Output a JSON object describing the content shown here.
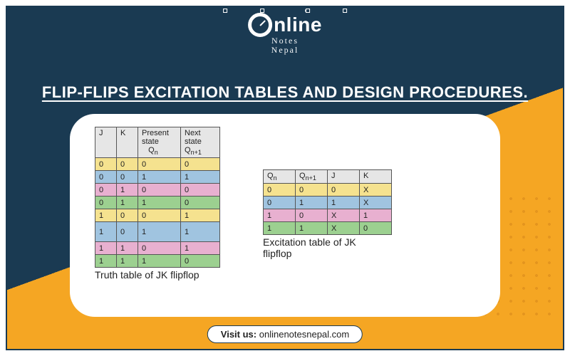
{
  "brand": {
    "main_text": "nline",
    "sub1": "Notes",
    "sub2": "Nepal"
  },
  "title": "FLIP-FLIPS EXCITATION TABLES AND DESIGN PROCEDURES.",
  "truth_table": {
    "headers": {
      "c0": "J",
      "c1": "K",
      "c2_l1": "Present",
      "c2_l2": "state",
      "c2_l3": "Q",
      "c2_sub": "n",
      "c3_l1": "Next",
      "c3_l2": "state",
      "c3_l3": "Q",
      "c3_sub": "n+1"
    },
    "rows": [
      {
        "c0": "0",
        "c1": "0",
        "c2": "0",
        "c3": "0"
      },
      {
        "c0": "0",
        "c1": "0",
        "c2": "1",
        "c3": "1"
      },
      {
        "c0": "0",
        "c1": "1",
        "c2": "0",
        "c3": "0"
      },
      {
        "c0": "0",
        "c1": "1",
        "c2": "1",
        "c3": "0"
      },
      {
        "c0": "1",
        "c1": "0",
        "c2": "0",
        "c3": "1"
      },
      {
        "c0": "1",
        "c1": "0",
        "c2": "1",
        "c3": "1"
      },
      {
        "c0": "1",
        "c1": "1",
        "c2": "0",
        "c3": "1"
      },
      {
        "c0": "1",
        "c1": "1",
        "c2": "1",
        "c3": "0"
      }
    ],
    "caption": "Truth table of JK flipflop"
  },
  "excitation_table": {
    "headers": {
      "c0": "Q",
      "c0_sub": "n",
      "c1": "Q",
      "c1_sub": "n+1",
      "c2": "J",
      "c3": "K"
    },
    "rows": [
      {
        "c0": "0",
        "c1": "0",
        "c2": "0",
        "c3": "X"
      },
      {
        "c0": "0",
        "c1": "1",
        "c2": "1",
        "c3": "X"
      },
      {
        "c0": "1",
        "c1": "0",
        "c2": "X",
        "c3": "1"
      },
      {
        "c0": "1",
        "c1": "1",
        "c2": "X",
        "c3": "0"
      }
    ],
    "caption_l1": "Excitation table of JK",
    "caption_l2": "flipflop"
  },
  "visit": {
    "label": "Visit us:",
    "url": "onlinenotesnepal.com"
  }
}
